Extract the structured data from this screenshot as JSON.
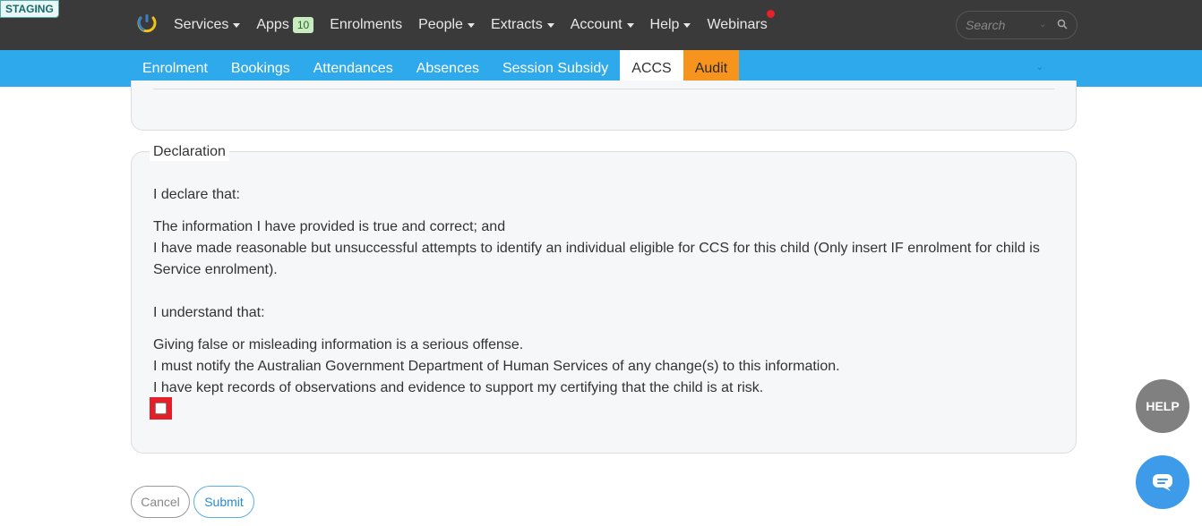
{
  "env_badge": "STAGING",
  "nav": {
    "services": "Services",
    "apps": "Apps",
    "apps_badge": "10",
    "enrolments": "Enrolments",
    "people": "People",
    "extracts": "Extracts",
    "account": "Account",
    "help": "Help",
    "webinars": "Webinars"
  },
  "search": {
    "placeholder": "Search"
  },
  "subnav": {
    "tabs": [
      {
        "label": "Enrolment"
      },
      {
        "label": "Bookings"
      },
      {
        "label": "Attendances"
      },
      {
        "label": "Absences"
      },
      {
        "label": "Session Subsidy"
      },
      {
        "label": "ACCS",
        "active": true
      },
      {
        "label": "Audit",
        "highlight": "#f7941d"
      }
    ]
  },
  "declaration": {
    "legend": "Declaration",
    "declare_heading": "I declare that:",
    "declare_line1": "The information I have provided is true and correct; and",
    "declare_line2": "I have made reasonable but unsuccessful attempts to identify an individual eligible for CCS for this child (Only insert IF enrolment for child is Service enrolment).",
    "understand_heading": "I understand that:",
    "understand_line1": "Giving false or misleading information is a serious offense.",
    "understand_line2": "I must notify the Australian Government Department of Human Services of any change(s) to this information.",
    "understand_line3": "I have kept records of observations and evidence to support my certifying that the child is at risk.",
    "checkbox_checked": false
  },
  "actions": {
    "cancel": "Cancel",
    "submit": "Submit"
  },
  "widgets": {
    "help": "HELP",
    "chat_icon": "chat-bubble-icon"
  },
  "colors": {
    "topbar": "#3a3a3a",
    "subnav": "#2ea9ec",
    "audit_tab": "#f7941d",
    "checkbox_highlight": "#e2202a",
    "notification_dot": "#e8202a"
  }
}
